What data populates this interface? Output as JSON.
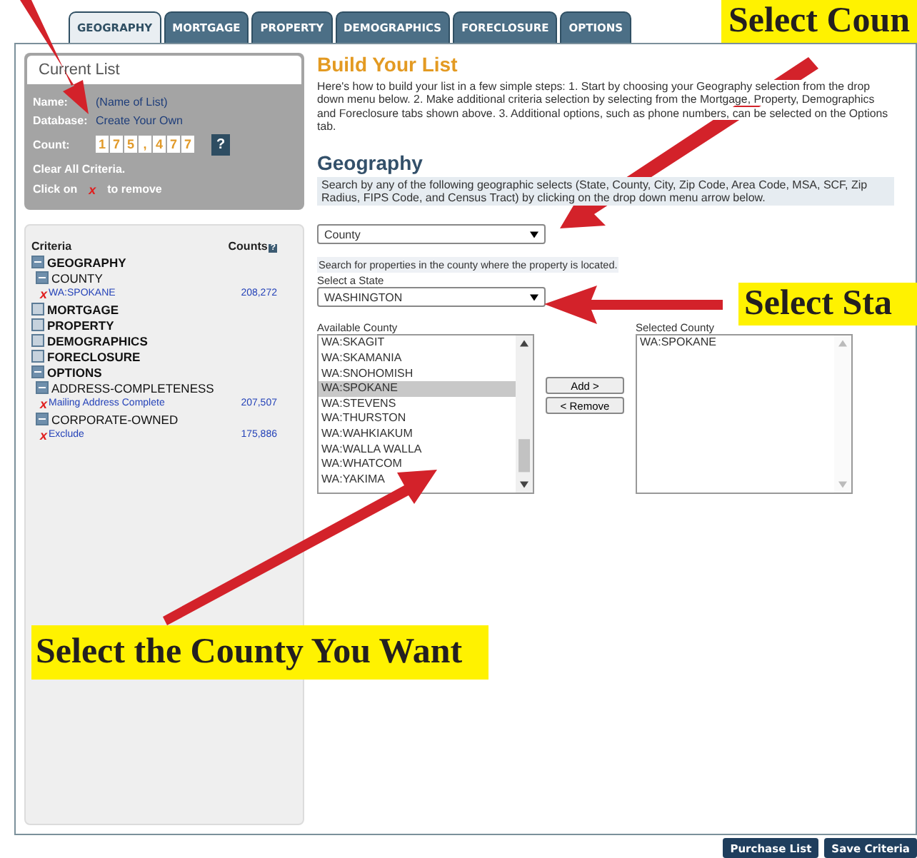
{
  "tabs": [
    {
      "label": "GEOGRAPHY",
      "selected": true
    },
    {
      "label": "MORTGAGE",
      "selected": false
    },
    {
      "label": "PROPERTY",
      "selected": false
    },
    {
      "label": "DEMOGRAPHICS",
      "selected": false
    },
    {
      "label": "FORECLOSURE",
      "selected": false
    },
    {
      "label": "OPTIONS",
      "selected": false
    }
  ],
  "current_list": {
    "title": "Current List",
    "name_label": "Name:",
    "name_value": "(Name of List)",
    "database_label": "Database:",
    "database_value": "Create Your Own",
    "count_label": "Count:",
    "count_digits": [
      "1",
      "7",
      "5",
      ",",
      "4",
      "7",
      "7"
    ],
    "help": "?",
    "clear": "Clear All Criteria.",
    "remove_before": "Click on",
    "remove_mark": "x",
    "remove_after": "to remove"
  },
  "criteria": {
    "heading": "Criteria",
    "counts_heading": "Counts",
    "counts_help": "?",
    "items": [
      {
        "label": "GEOGRAPHY",
        "kind": "group",
        "expanded": true,
        "children": [
          {
            "label": "COUNTY",
            "kind": "field",
            "expanded": true,
            "children": [
              {
                "label": "WA:SPOKANE",
                "kind": "value",
                "remove_mark": "x",
                "count": "208,272"
              }
            ]
          }
        ]
      },
      {
        "label": "MORTGAGE",
        "kind": "group",
        "expanded": false
      },
      {
        "label": "PROPERTY",
        "kind": "group",
        "expanded": false
      },
      {
        "label": "DEMOGRAPHICS",
        "kind": "group",
        "expanded": false
      },
      {
        "label": "FORECLOSURE",
        "kind": "group",
        "expanded": false
      },
      {
        "label": "OPTIONS",
        "kind": "group",
        "expanded": true,
        "children": [
          {
            "label": "ADDRESS-COMPLETENESS",
            "kind": "field",
            "expanded": true,
            "children": [
              {
                "label": "Mailing Address Complete",
                "kind": "value",
                "remove_mark": "x",
                "count": "207,507"
              }
            ]
          },
          {
            "label": "CORPORATE-OWNED",
            "kind": "field",
            "expanded": true,
            "children": [
              {
                "label": "Exclude",
                "kind": "value",
                "remove_mark": "x",
                "count": "175,886"
              }
            ]
          }
        ]
      }
    ]
  },
  "build": {
    "title": "Build Your List",
    "intro": "Here's how to build your list in a few simple steps: 1. Start by choosing your Geography selection from the drop down menu below. 2. Make additional criteria selection by selecting from the Mortgage, Property, Demographics and Foreclosure tabs shown above. 3. Additional options, such as phone numbers, can be selected on the Options tab."
  },
  "geography": {
    "title": "Geography",
    "hint": "Search by any of the following geographic selects (State, County, City, Zip Code, Area Code, MSA, SCF, Zip Radius, FIPS Code, and Census Tract) by clicking on the drop down menu arrow below.",
    "select_value": "County",
    "select_hint": "Search for properties in the county where the property is located.",
    "state_label": "Select a State",
    "state_value": "WASHINGTON",
    "available_label": "Available County",
    "available": [
      {
        "label": "WA:SKAGIT",
        "selected": false
      },
      {
        "label": "WA:SKAMANIA",
        "selected": false
      },
      {
        "label": "WA:SNOHOMISH",
        "selected": false
      },
      {
        "label": "WA:SPOKANE",
        "selected": true
      },
      {
        "label": "WA:STEVENS",
        "selected": false
      },
      {
        "label": "WA:THURSTON",
        "selected": false
      },
      {
        "label": "WA:WAHKIAKUM",
        "selected": false
      },
      {
        "label": "WA:WALLA WALLA",
        "selected": false
      },
      {
        "label": "WA:WHATCOM",
        "selected": false
      },
      {
        "label": "WA:YAKIMA",
        "selected": false
      }
    ],
    "add": "Add >",
    "remove": "< Remove",
    "selected_label": "Selected County",
    "selected": [
      "WA:SPOKANE"
    ]
  },
  "buttons": [
    "Purchase List",
    "Save Criteria"
  ],
  "callouts": [
    "Select Coun",
    "Select Sta",
    "Select the County You Want"
  ]
}
